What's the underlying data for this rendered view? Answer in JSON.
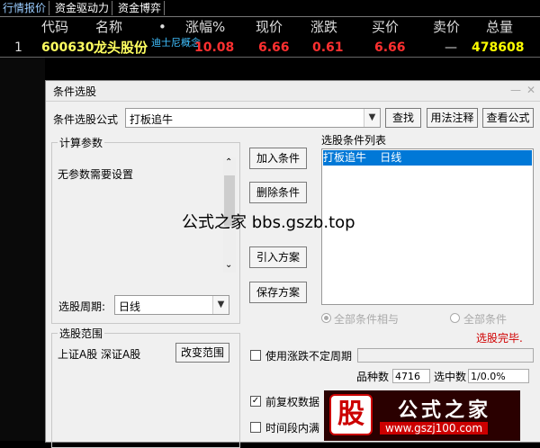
{
  "tabs": [
    "行情报价",
    "资金驱动力",
    "资金博弈"
  ],
  "quote_table": {
    "headers": [
      "代码",
      "名称",
      "•",
      "涨幅%",
      "现价",
      "涨跌",
      "买价",
      "卖价",
      "总量"
    ],
    "row": {
      "index": "1",
      "code": "600630",
      "name": "龙头股份",
      "concept": "迪士尼概念",
      "change_pct": "10.08",
      "price": "6.66",
      "change": "0.61",
      "bid": "6.66",
      "ask": "—",
      "volume": "478608"
    }
  },
  "dialog": {
    "title": "条件选股",
    "formula_label": "条件选股公式",
    "formula_value": "打板追牛",
    "buttons": {
      "find": "查找",
      "usage": "用法注释",
      "view": "查看公式",
      "add": "加入条件",
      "delete": "删除条件",
      "import": "引入方案",
      "save": "保存方案",
      "change_range": "改变范围"
    },
    "params_title": "计算参数",
    "params_text": "无参数需要设置",
    "condition_list_title": "选股条件列表",
    "condition_item": "打板追牛    日线",
    "period_label": "选股周期:",
    "period_value": "日线",
    "range_title": "选股范围",
    "range_values": "上证A股  深证A股",
    "radio_all_and": "全部条件相与",
    "radio_all_or": "全部条件",
    "status": "选股完毕.",
    "use_indeterminate_label": "使用涨跌不定周期",
    "pinzhong_label": "品种数",
    "pinzhong_value": "4716",
    "selected_label": "选中数",
    "selected_value": "1/0.0%",
    "adjust_label": "前复权数据",
    "interval_label": "时间段内满"
  },
  "watermark": "公式之家 bbs.gszb.top",
  "logo": {
    "glyph": "股",
    "name": "公式之家",
    "url": "www.gszj100.com"
  },
  "colors": {
    "up": "#ff3030",
    "yellow": "#ffff00",
    "selection": "#0078d7"
  }
}
